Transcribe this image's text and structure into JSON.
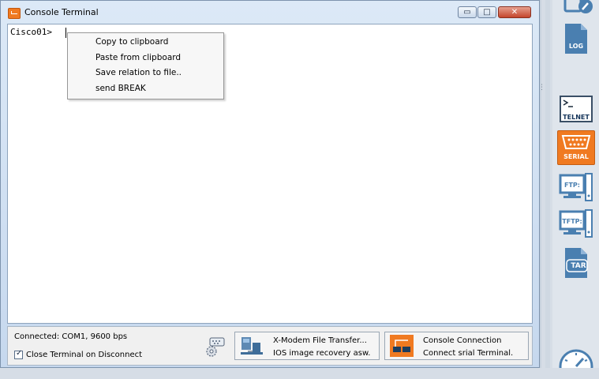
{
  "window": {
    "title": "Console Terminal",
    "minimize_glyph": "▭",
    "maximize_glyph": "□",
    "close_glyph": "✕"
  },
  "terminal": {
    "prompt": "Cisco01>"
  },
  "context_menu": {
    "items": [
      {
        "label": "Copy to clipboard"
      },
      {
        "label": "Paste from clipboard"
      },
      {
        "label": "Save relation to file.."
      },
      {
        "label": "send BREAK"
      }
    ]
  },
  "status": {
    "connection": "Connected: COM1, 9600 bps",
    "close_on_disconnect": {
      "label": "Close Terminal on Disconnect",
      "checked": true
    }
  },
  "actions": {
    "xmodem": {
      "line1": "X-Modem File Transfer...",
      "line2": "IOS image  recovery asw."
    },
    "console": {
      "line1": "Console Connection",
      "line2": "Connect srial Terminal."
    }
  },
  "toolbar": {
    "items": [
      {
        "name": "edit",
        "icon": "edit-icon",
        "label": ""
      },
      {
        "name": "log",
        "icon": "log-file-icon",
        "label": "LOG"
      },
      {
        "name": "telnet",
        "icon": "telnet-icon",
        "label": "TELNET"
      },
      {
        "name": "serial",
        "icon": "serial-port-icon",
        "label": "SERIAL",
        "active": true
      },
      {
        "name": "ftp",
        "icon": "ftp-icon",
        "label": "FTP:"
      },
      {
        "name": "tftp",
        "icon": "tftp-icon",
        "label": "TFTP:"
      },
      {
        "name": "tar",
        "icon": "tar-file-icon",
        "label": "TAR"
      },
      {
        "name": "speed",
        "icon": "gauge-icon",
        "label": ""
      }
    ]
  },
  "colors": {
    "accent": "#f07a21",
    "icon_blue": "#4a7fb0"
  }
}
